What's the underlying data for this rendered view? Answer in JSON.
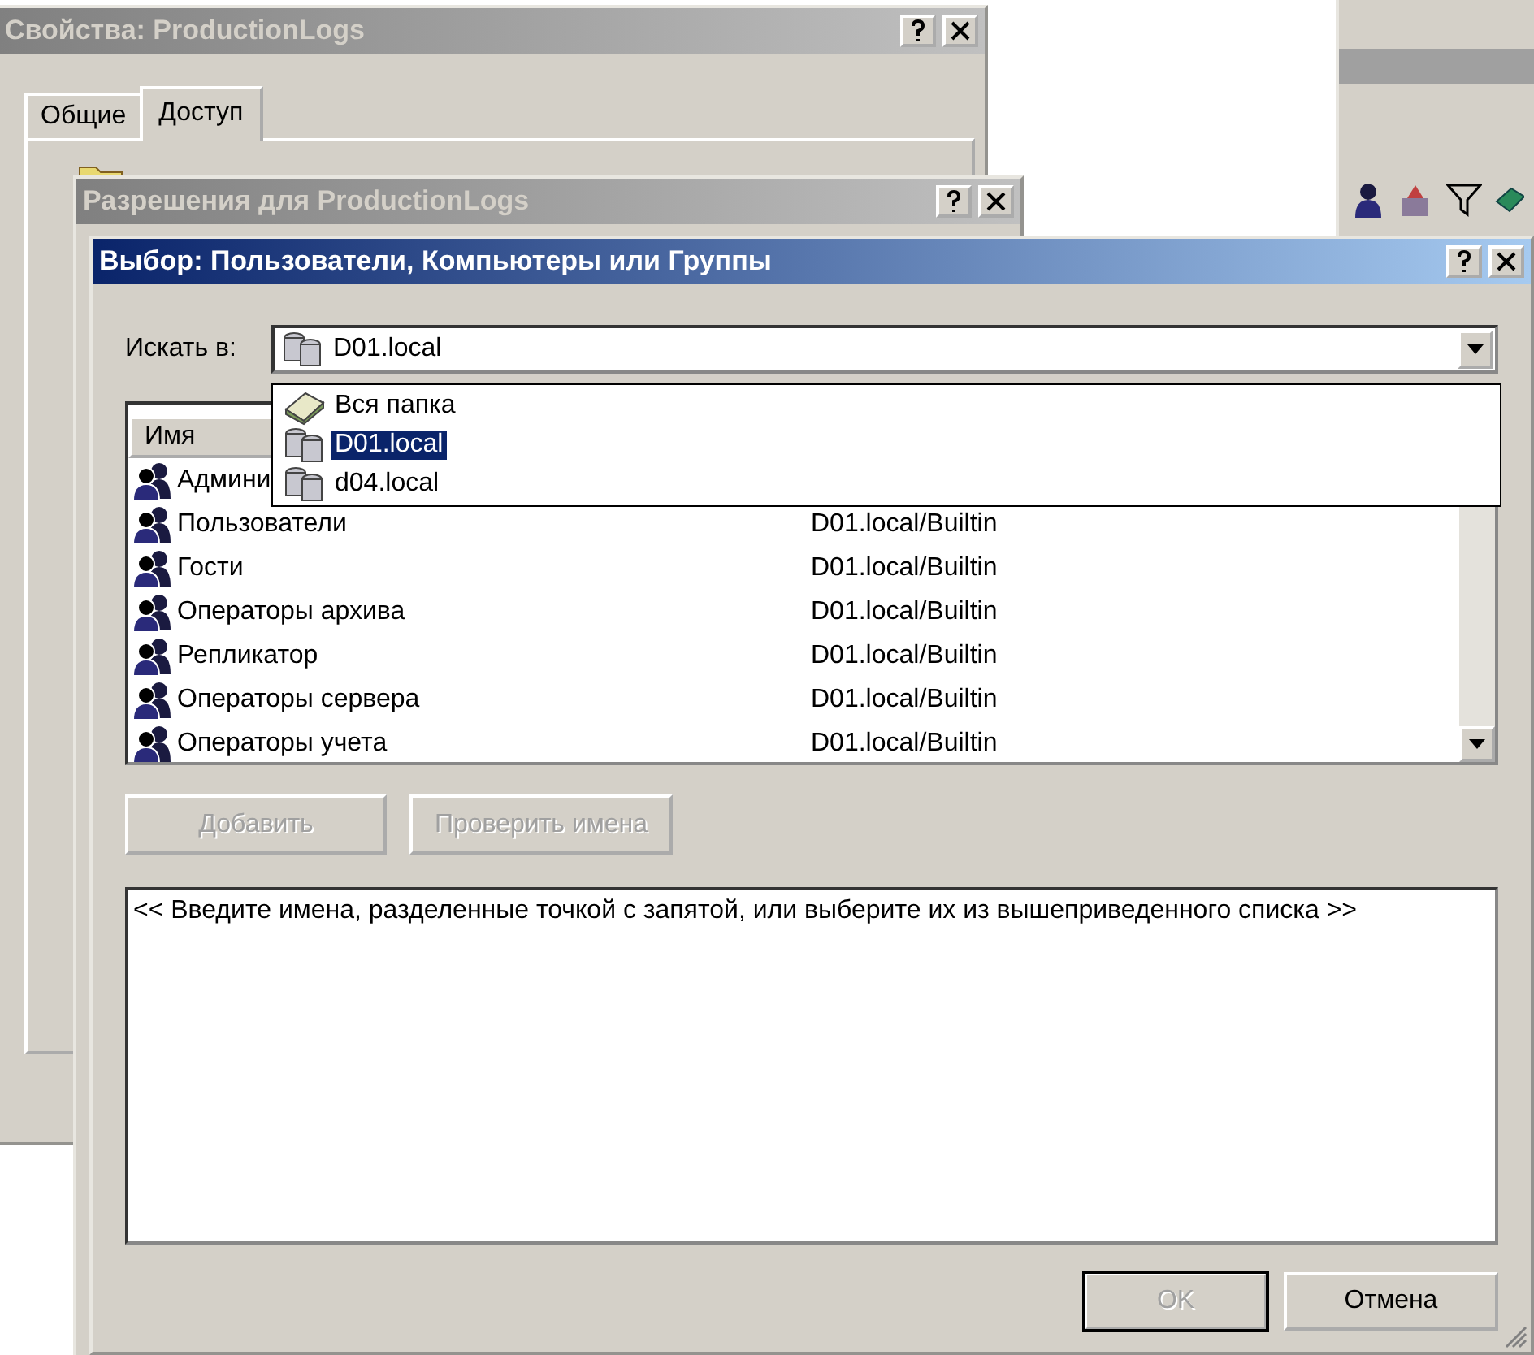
{
  "windows": [
    {
      "kind": "properties",
      "title": "Свойства: ProductionLogs",
      "active": false,
      "tabs": [
        {
          "label": "Общие",
          "selected": false
        },
        {
          "label": "Доступ",
          "selected": true
        }
      ]
    },
    {
      "kind": "permissions",
      "title": "Разрешения для ProductionLogs",
      "active": false
    }
  ],
  "dialog": {
    "title": "Выбор: Пользователи, Компьютеры или Группы",
    "active": true,
    "look_in": {
      "label": "Искать в:",
      "value": "D01.local"
    },
    "dropdown": {
      "expanded": true,
      "items": [
        {
          "label": "Вся папка",
          "kind": "directory",
          "selected": false
        },
        {
          "label": "D01.local",
          "kind": "domain",
          "selected": true
        },
        {
          "label": "d04.local",
          "kind": "domain",
          "selected": false
        }
      ]
    },
    "list": {
      "columns": [
        "Имя"
      ],
      "rows": [
        {
          "name": "Админи"
        },
        {
          "name": "Пользователи",
          "location": "D01.local/Builtin"
        },
        {
          "name": "Гости",
          "location": "D01.local/Builtin"
        },
        {
          "name": "Операторы архива",
          "location": "D01.local/Builtin"
        },
        {
          "name": "Репликатор",
          "location": "D01.local/Builtin"
        },
        {
          "name": "Операторы сервера",
          "location": "D01.local/Builtin"
        },
        {
          "name": "Операторы учета",
          "location": "D01.local/Builtin"
        }
      ]
    },
    "buttons": [
      {
        "label": "Добавить",
        "disabled": true
      },
      {
        "label": "Проверить имена",
        "disabled": true
      }
    ],
    "names_field": {
      "placeholder": "<< Введите имена, разделенные точкой с запятой, или выберите их из вышеприведенного списка >>"
    },
    "footer_buttons": [
      {
        "label": "OK",
        "disabled": true,
        "default": true
      },
      {
        "label": "Отмена",
        "disabled": false,
        "default": false
      }
    ]
  }
}
